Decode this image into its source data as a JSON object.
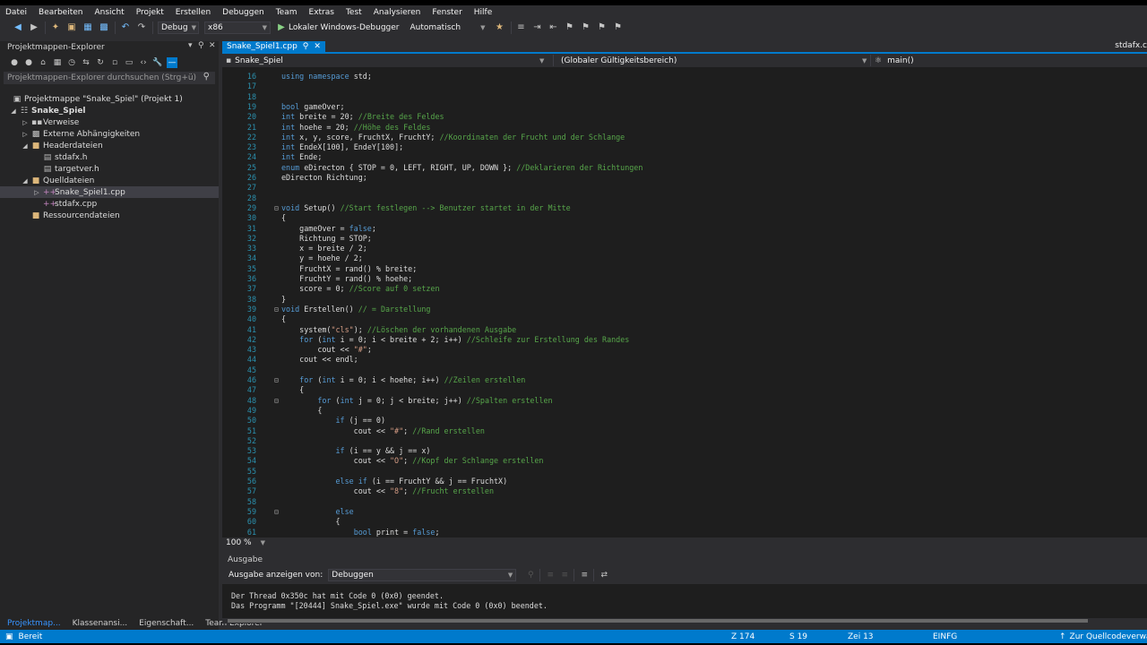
{
  "menu": [
    "Datei",
    "Bearbeiten",
    "Ansicht",
    "Projekt",
    "Erstellen",
    "Debuggen",
    "Team",
    "Extras",
    "Test",
    "Analysieren",
    "Fenster",
    "Hilfe"
  ],
  "toolbar": {
    "configuration": "Debug",
    "platform": "x86",
    "debugger": "Lokaler Windows-Debugger",
    "debugger_mode": "Automatisch",
    "icons": [
      "back-icon",
      "forward-icon",
      "new-project-icon",
      "open-icon",
      "save-icon",
      "save-all-icon",
      "undo-icon",
      "redo-icon",
      "play-icon"
    ]
  },
  "explorer": {
    "title": "Projektmappen-Explorer",
    "search_placeholder": "Projektmappen-Explorer durchsuchen (Strg+ü)",
    "tree": [
      {
        "label": "Projektmappe \"Snake_Spiel\" (Projekt 1)",
        "icon": "solution-icon"
      },
      {
        "label": "Snake_Spiel",
        "icon": "project-icon"
      },
      {
        "label": "Verweise",
        "icon": "references-icon"
      },
      {
        "label": "Externe Abhängigkeiten",
        "icon": "dependencies-icon"
      },
      {
        "label": "Headerdateien",
        "icon": "folder-icon"
      },
      {
        "label": "stdafx.h",
        "icon": "header-file-icon"
      },
      {
        "label": "targetver.h",
        "icon": "header-file-icon"
      },
      {
        "label": "Quelldateien",
        "icon": "folder-icon"
      },
      {
        "label": "Snake_Spiel1.cpp",
        "icon": "cpp-file-icon"
      },
      {
        "label": "stdafx.cpp",
        "icon": "cpp-file-icon"
      },
      {
        "label": "Ressourcendateien",
        "icon": "folder-icon"
      }
    ],
    "bottom_tabs": [
      "Projektmap...",
      "Klassenansi...",
      "Eigenschaft...",
      "Team Explorer"
    ]
  },
  "editor": {
    "tab": "Snake_Spiel1.cpp",
    "right_tab": "stdafx.c",
    "nav_project": "Snake_Spiel",
    "nav_scope": "(Globaler Gültigkeitsbereich)",
    "nav_member": "main()",
    "zoom": "100 %",
    "lines": [
      {
        "n": "16",
        "t": "using namespace std;"
      },
      {
        "n": "17",
        "t": ""
      },
      {
        "n": "18",
        "t": ""
      },
      {
        "n": "19",
        "t": "bool gameOver;"
      },
      {
        "n": "20",
        "t": "int breite = 20; //Breite des Feldes"
      },
      {
        "n": "21",
        "t": "int hoehe = 20; //Höhe des Feldes"
      },
      {
        "n": "22",
        "t": "int x, y, score, FruchtX, FruchtY; //Koordinaten der Frucht und der Schlange"
      },
      {
        "n": "23",
        "t": "int EndeX[100], EndeY[100];"
      },
      {
        "n": "24",
        "t": "int Ende;"
      },
      {
        "n": "25",
        "t": "enum eDirecton { STOP = 0, LEFT, RIGHT, UP, DOWN }; //Deklarieren der Richtungen"
      },
      {
        "n": "26",
        "t": "eDirecton Richtung;"
      },
      {
        "n": "27",
        "t": ""
      },
      {
        "n": "28",
        "t": ""
      },
      {
        "n": "29",
        "t": "void Setup() //Start festlegen --> Benutzer startet in der Mitte"
      },
      {
        "n": "30",
        "t": "{"
      },
      {
        "n": "31",
        "t": "    gameOver = false;"
      },
      {
        "n": "32",
        "t": "    Richtung = STOP;"
      },
      {
        "n": "33",
        "t": "    x = breite / 2;"
      },
      {
        "n": "34",
        "t": "    y = hoehe / 2;"
      },
      {
        "n": "35",
        "t": "    FruchtX = rand() % breite;"
      },
      {
        "n": "36",
        "t": "    FruchtY = rand() % hoehe;"
      },
      {
        "n": "37",
        "t": "    score = 0; //Score auf 0 setzen"
      },
      {
        "n": "38",
        "t": "}"
      },
      {
        "n": "39",
        "t": "void Erstellen() // = Darstellung"
      },
      {
        "n": "40",
        "t": "{"
      },
      {
        "n": "41",
        "t": "    system(\"cls\"); //Löschen der vorhandenen Ausgabe"
      },
      {
        "n": "42",
        "t": "    for (int i = 0; i < breite + 2; i++) //Schleife zur Erstellung des Randes"
      },
      {
        "n": "43",
        "t": "        cout << \"#\";"
      },
      {
        "n": "44",
        "t": "    cout << endl;"
      },
      {
        "n": "45",
        "t": ""
      },
      {
        "n": "46",
        "t": "    for (int i = 0; i < hoehe; i++) //Zeilen erstellen"
      },
      {
        "n": "47",
        "t": "    {"
      },
      {
        "n": "48",
        "t": "        for (int j = 0; j < breite; j++) //Spalten erstellen"
      },
      {
        "n": "49",
        "t": "        {"
      },
      {
        "n": "50",
        "t": "            if (j == 0)"
      },
      {
        "n": "51",
        "t": "                cout << \"#\"; //Rand erstellen"
      },
      {
        "n": "52",
        "t": ""
      },
      {
        "n": "53",
        "t": "            if (i == y && j == x)"
      },
      {
        "n": "54",
        "t": "                cout << \"O\"; //Kopf der Schlange erstellen"
      },
      {
        "n": "55",
        "t": ""
      },
      {
        "n": "56",
        "t": "            else if (i == FruchtY && j == FruchtX)"
      },
      {
        "n": "57",
        "t": "                cout << \"8\"; //Frucht erstellen"
      },
      {
        "n": "58",
        "t": ""
      },
      {
        "n": "59",
        "t": "            else"
      },
      {
        "n": "60",
        "t": "            {"
      },
      {
        "n": "61",
        "t": "                bool print = false;"
      },
      {
        "n": "62",
        "t": ""
      }
    ]
  },
  "output": {
    "title": "Ausgabe",
    "show_label": "Ausgabe anzeigen von:",
    "source": "Debuggen",
    "lines": [
      "Der Thread 0x350c hat mit Code 0 (0x0) geendet.",
      "Das Programm \"[20444] Snake_Spiel.exe\" wurde mit Code 0 (0x0) beendet."
    ]
  },
  "status": {
    "ready": "Bereit",
    "line": "Z 174",
    "col": "S 19",
    "char": "Zei 13",
    "mode": "EINFG",
    "source_control": "Zur Quellcodeverwaltung hinzufügen"
  },
  "colors": {
    "accent": "#007acc",
    "background": "#2d2d30",
    "editor_bg": "#1e1e1e",
    "keyword": "#569cd6",
    "comment": "#57a64a",
    "string": "#d69d85"
  }
}
